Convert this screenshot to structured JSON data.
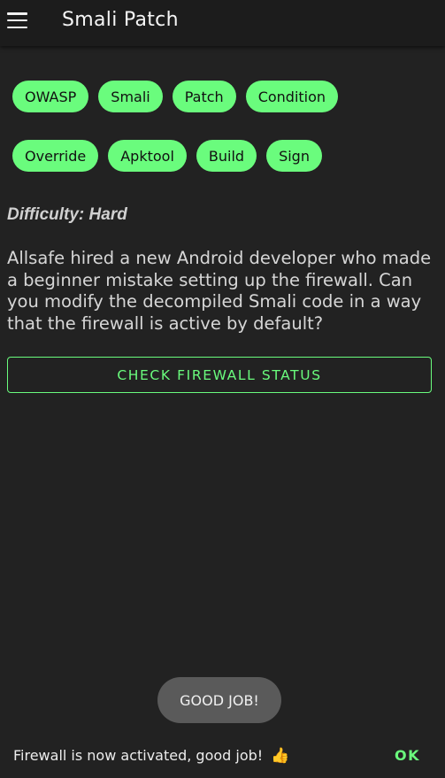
{
  "appbar": {
    "title": "Smali Patch",
    "menu_icon": "hamburger-menu-icon"
  },
  "tags": {
    "row1": [
      "OWASP",
      "Smali",
      "Patch",
      "Condition"
    ],
    "row2": [
      "Override",
      "Apktool",
      "Build",
      "Sign"
    ]
  },
  "challenge": {
    "difficulty": "Difficulty: Hard",
    "description": "Allsafe hired a new Android developer who made a beginner mistake setting up the firewall. Can you modify the decompiled Smali code in a way that the firewall is active by default?",
    "button_label": "CHECK FIREWALL STATUS"
  },
  "toast": {
    "message": "GOOD JOB!"
  },
  "snackbar": {
    "message": "Firewall is now activated, good job!",
    "icon": "thumbs-up-icon",
    "icon_glyph": "👍",
    "action": "OK"
  },
  "colors": {
    "accent": "#6afc7d",
    "background": "#222222",
    "appbar": "#1c1c1c",
    "toast": "#5a5a5a"
  }
}
